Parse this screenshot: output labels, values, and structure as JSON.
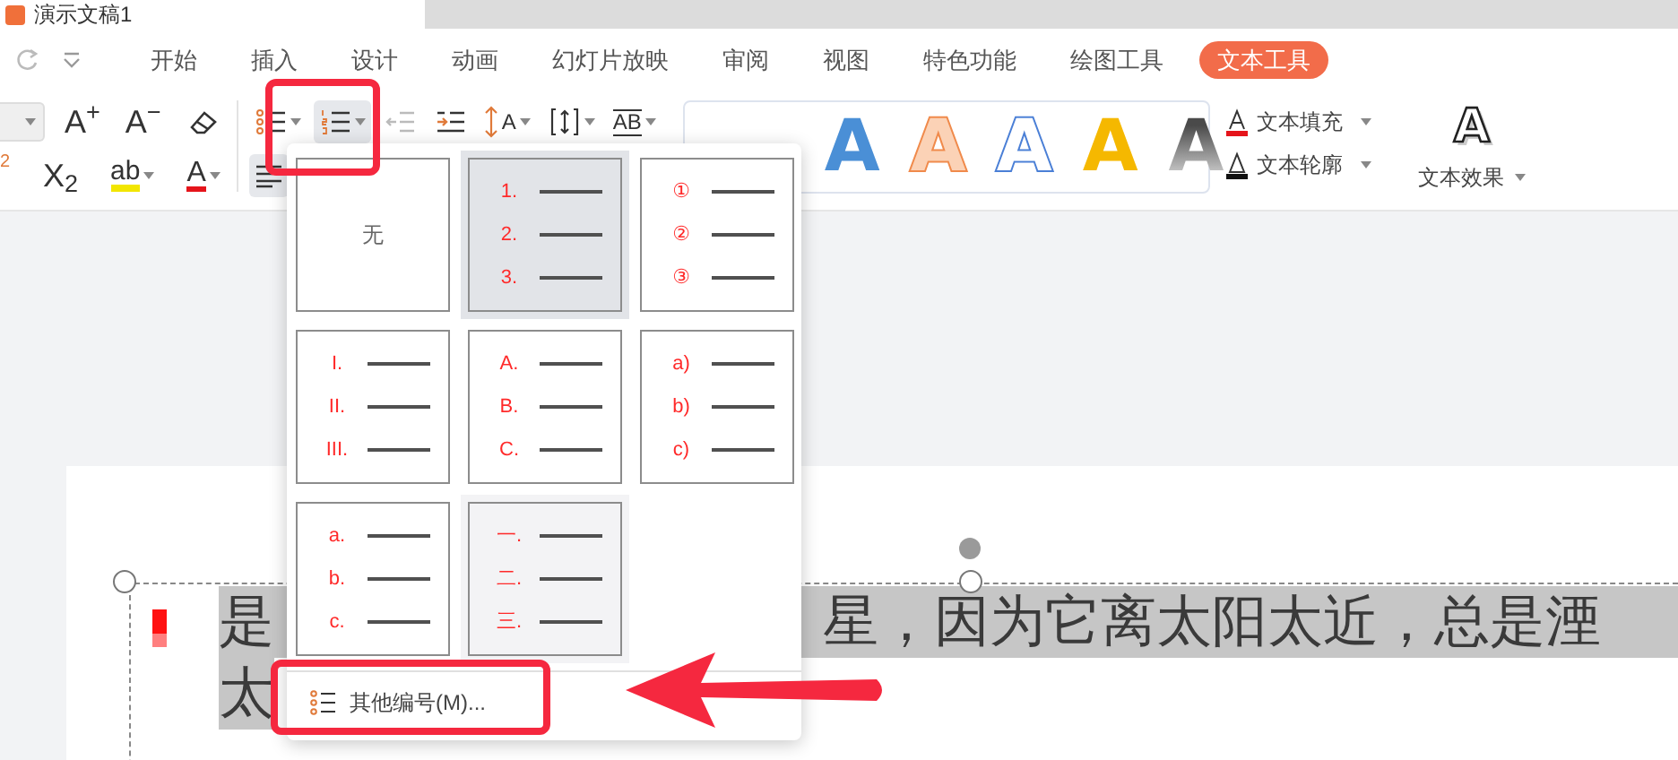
{
  "document_tab": {
    "title": "演示文稿1"
  },
  "menu_tabs": [
    {
      "label": "开始",
      "selected": false
    },
    {
      "label": "插入",
      "selected": false
    },
    {
      "label": "设计",
      "selected": false
    },
    {
      "label": "动画",
      "selected": false
    },
    {
      "label": "幻灯片放映",
      "selected": false
    },
    {
      "label": "审阅",
      "selected": false
    },
    {
      "label": "视图",
      "selected": false
    },
    {
      "label": "特色功能",
      "selected": false
    },
    {
      "label": "绘图工具",
      "selected": false
    },
    {
      "label": "文本工具",
      "selected": true
    }
  ],
  "font_tools_top": [
    {
      "kind": "font-size"
    },
    {
      "kind": "grow",
      "glyph": "A$^{+}$"
    },
    {
      "kind": "shrink",
      "glyph": "A$^{−}$"
    },
    {
      "kind": "clear"
    }
  ],
  "font_tools_bottom": [
    {
      "kind": "superscript",
      "glyph": "2"
    },
    {
      "kind": "subscript",
      "glyph": "X$_{2}$"
    },
    {
      "kind": "highlight",
      "glyph": "ab"
    },
    {
      "kind": "font-color",
      "glyph": "A"
    }
  ],
  "paragraph_tools_top": [
    {
      "kind": "bullets",
      "active": false
    },
    {
      "kind": "numbering",
      "active": true
    },
    {
      "kind": "outdent",
      "active": false
    },
    {
      "kind": "indent",
      "active": false
    },
    {
      "kind": "line-spacing",
      "glyph": "A",
      "active": false
    },
    {
      "kind": "para-spacing",
      "active": false
    },
    {
      "kind": "direction",
      "glyph": "AB",
      "active": false
    }
  ],
  "paragraph_tools_bottom": [
    {
      "kind": "align-left",
      "active": true
    }
  ],
  "text_styles": [
    {
      "glyph": "A",
      "kind": "solid",
      "color": "#4a8fd6"
    },
    {
      "glyph": "A",
      "kind": "soft-outline"
    },
    {
      "glyph": "A",
      "kind": "outline"
    },
    {
      "glyph": "A",
      "kind": "solid",
      "color": "#f5b800"
    },
    {
      "glyph": "A",
      "kind": "gradient"
    }
  ],
  "text_commands": [
    {
      "kind": "fill",
      "label": "文本填充"
    },
    {
      "kind": "outline",
      "label": "文本轮廓"
    }
  ],
  "text_effect": {
    "glyph": "A",
    "label": "文本效果"
  },
  "slide_lines": [
    {
      "marker": true,
      "parts": [
        "是",
        "星，因为它离太阳太近，总是湮"
      ]
    },
    {
      "marker": false,
      "parts": [
        "太"
      ]
    }
  ],
  "numbering_menu": {
    "styles": [
      {
        "kind": "none",
        "label": "无",
        "selected": false,
        "hovered": false
      },
      {
        "kind": "list",
        "markers": [
          "1.",
          "2.",
          "3."
        ],
        "selected": true,
        "hovered": false
      },
      {
        "kind": "list",
        "markers": [
          "①",
          "②",
          "③"
        ],
        "selected": false,
        "hovered": false
      },
      {
        "kind": "list",
        "markers": [
          "I.",
          "II.",
          "III."
        ],
        "selected": false,
        "hovered": false
      },
      {
        "kind": "list",
        "markers": [
          "A.",
          "B.",
          "C."
        ],
        "selected": false,
        "hovered": false
      },
      {
        "kind": "list",
        "markers": [
          "a)",
          "b)",
          "c)"
        ],
        "selected": false,
        "hovered": false
      },
      {
        "kind": "list",
        "markers": [
          "a.",
          "b.",
          "c."
        ],
        "selected": false,
        "hovered": false
      },
      {
        "kind": "list",
        "markers": [
          "一.",
          "二.",
          "三."
        ],
        "selected": false,
        "hovered": true
      }
    ],
    "more": "其他编号(M)..."
  }
}
